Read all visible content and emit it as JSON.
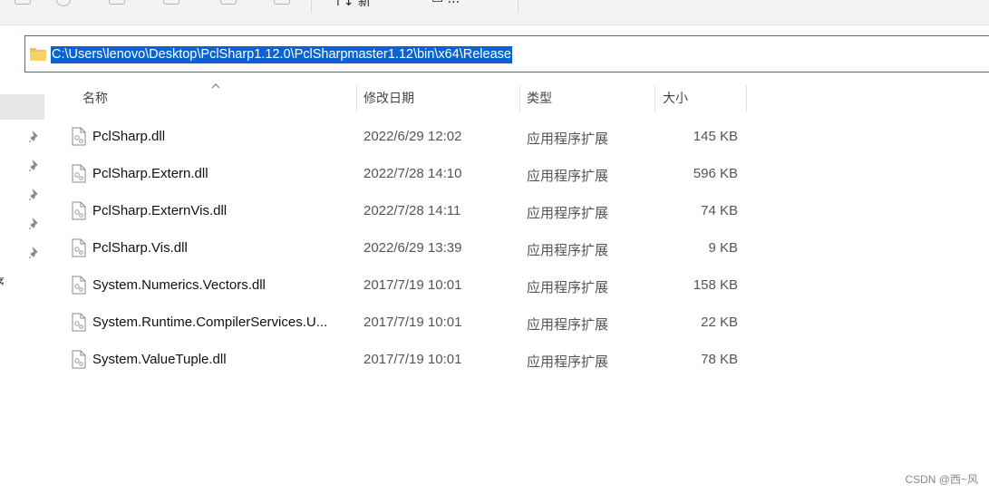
{
  "toolbar": {
    "view_label": "新",
    "more_label": "..."
  },
  "address": {
    "path": "C:\\Users\\lenovo\\Desktop\\PclSharp1.12.0\\PclSharpmaster1.12\\bin\\x64\\Release"
  },
  "nav": {
    "partial_char": "序"
  },
  "columns": {
    "name": "名称",
    "modified": "修改日期",
    "type": "类型",
    "size": "大小"
  },
  "files": [
    {
      "name": "PclSharp.dll",
      "modified": "2022/6/29 12:02",
      "type": "应用程序扩展",
      "size": "145 KB"
    },
    {
      "name": "PclSharp.Extern.dll",
      "modified": "2022/7/28 14:10",
      "type": "应用程序扩展",
      "size": "596 KB"
    },
    {
      "name": "PclSharp.ExternVis.dll",
      "modified": "2022/7/28 14:11",
      "type": "应用程序扩展",
      "size": "74 KB"
    },
    {
      "name": "PclSharp.Vis.dll",
      "modified": "2022/6/29 13:39",
      "type": "应用程序扩展",
      "size": "9 KB"
    },
    {
      "name": "System.Numerics.Vectors.dll",
      "modified": "2017/7/19 10:01",
      "type": "应用程序扩展",
      "size": "158 KB"
    },
    {
      "name": "System.Runtime.CompilerServices.U...",
      "modified": "2017/7/19 10:01",
      "type": "应用程序扩展",
      "size": "22 KB"
    },
    {
      "name": "System.ValueTuple.dll",
      "modified": "2017/7/19 10:01",
      "type": "应用程序扩展",
      "size": "78 KB"
    }
  ],
  "watermark": "CSDN @西~风",
  "colors": {
    "selection": "#0a63d4",
    "address_border": "#2b6fd6",
    "folder": "#f2c14e"
  }
}
